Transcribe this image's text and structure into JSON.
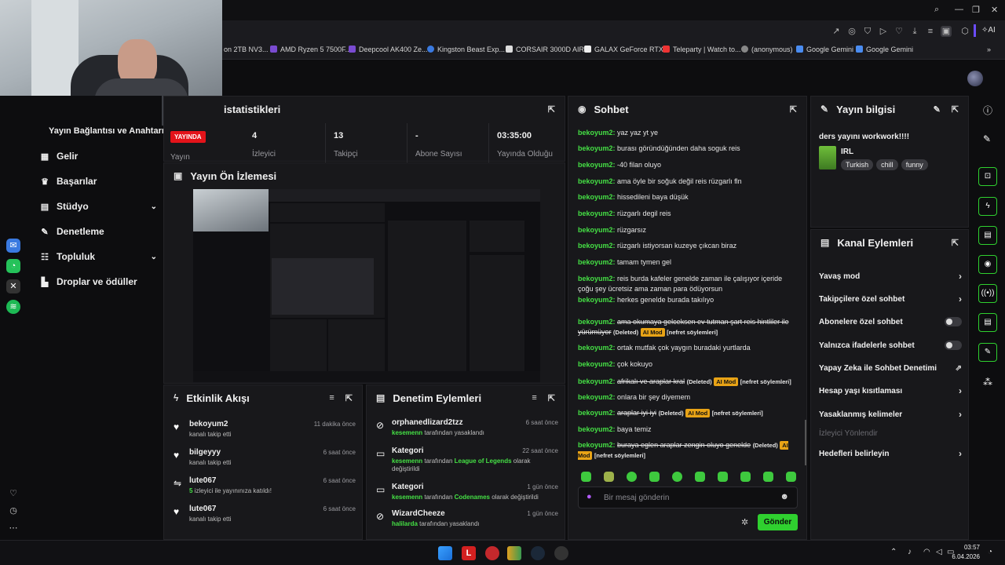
{
  "browser": {
    "bookmarks": [
      "on 2TB NV3...",
      "AMD Ryzen 5 7500F...",
      "Deepcool AK400 Ze...",
      "Kingston Beast Exp...",
      "CORSAIR 3000D AIR...",
      "GALAX GeForce RTX...",
      "Teleparty | Watch to...",
      "(anonymous)",
      "Google Gemini",
      "Google Gemini"
    ],
    "ai_label": "AI"
  },
  "sidebar": {
    "section_title": "Yayın Bağlantısı ve Anahtarı",
    "items": [
      {
        "label": "Gelir",
        "icon": "dollar-icon"
      },
      {
        "label": "Başarılar",
        "icon": "trophy-icon"
      },
      {
        "label": "Stüdyo",
        "icon": "studio-icon",
        "expandable": true
      },
      {
        "label": "Denetleme",
        "icon": "wrench-icon"
      },
      {
        "label": "Topluluk",
        "icon": "community-icon",
        "expandable": true
      },
      {
        "label": "Droplar ve ödüller",
        "icon": "drops-icon"
      }
    ]
  },
  "stats": {
    "title": "istatistikleri",
    "live_badge": "YAYINDA",
    "live_label": "Yayın",
    "items": [
      {
        "value": "4",
        "label": "İzleyici"
      },
      {
        "value": "13",
        "label": "Takipçi"
      },
      {
        "value": "-",
        "label": "Abone Sayısı"
      },
      {
        "value": "03:35:00",
        "label": "Yayında Olduğu"
      }
    ]
  },
  "preview": {
    "title": "Yayın Ön İzlemesi"
  },
  "activity": {
    "title": "Etkinlik Akışı",
    "items": [
      {
        "name": "bekoyum2",
        "sub": "kanalı takip etti",
        "time": "11 dakika önce",
        "icon": "heart-icon"
      },
      {
        "name": "bilgeyyy",
        "sub": "kanalı takip etti",
        "time": "6 saat önce",
        "icon": "heart-icon"
      },
      {
        "name": "lute067",
        "count": "5",
        "sub": " izleyici ile yayınınıza katıldı!",
        "time": "6 saat önce",
        "icon": "raid-icon"
      },
      {
        "name": "lute067",
        "sub": "kanalı takip etti",
        "time": "6 saat önce",
        "icon": "heart-icon"
      }
    ]
  },
  "modactions": {
    "title": "Denetim Eylemleri",
    "items": [
      {
        "name": "orphanedlizard2tzz",
        "actor": "kesemenn",
        "text": " tarafından yasaklandı",
        "time": "6 saat önce",
        "icon": "ban-icon"
      },
      {
        "name": "Kategori",
        "actor": "kesemenn",
        "text": " tarafından ",
        "target": "League of Legends",
        "text2": " olarak değiştirildi",
        "time": "22 saat önce",
        "icon": "category-icon"
      },
      {
        "name": "Kategori",
        "actor": "kesemenn",
        "text": " tarafından ",
        "target": "Codenames",
        "text2": " olarak değiştirildi",
        "time": "1 gün önce",
        "icon": "category-icon"
      },
      {
        "name": "WizardCheeze",
        "actor": "halilarda",
        "text": " tarafından yasaklandı",
        "time": "1 gün önce",
        "icon": "ban-icon"
      }
    ]
  },
  "chat": {
    "title": "Sohbet",
    "user": "bekoyum2:",
    "messages": [
      {
        "text": "yaz yaz yt ye"
      },
      {
        "text": "burası göründüğünden daha soguk reis"
      },
      {
        "text": "-40 filan oluyo"
      },
      {
        "text": "ama öyle bir soğuk değil reis rüzgarlı fln"
      },
      {
        "text": "hissedileni baya düşük"
      },
      {
        "text": "rüzgarlı degil reis"
      },
      {
        "text": "rüzgarsız"
      },
      {
        "text": "rüzgarlı istiyorsan kuzeye çıkcan biraz"
      },
      {
        "text": "tamam tymen gel"
      },
      {
        "text": "reis burda kafeler genelde zaman ile çalışıyor içeride çoğu şey ücretsiz ama zaman para ödüyorsun"
      },
      {
        "text": "herkes genelde burada takılıyo"
      },
      {
        "text": "ama okumaya gelceksen ev tutman şart reis hintliler ile yürümüyor",
        "deleted": true
      },
      {
        "text": "ortak mutfak çok yaygın buradaki yurtlarda"
      },
      {
        "text": "çok kokuyo"
      },
      {
        "text": "afrikalı ve araplar kral",
        "deleted": true
      },
      {
        "text": "onlara bir şey diyemem"
      },
      {
        "text": "araplar iyi iyi",
        "deleted": true
      },
      {
        "text": "baya temiz"
      },
      {
        "text": "buraya eglen araplar zengin oluyo genelde",
        "deleted": true
      }
    ],
    "deleted_label": "(Deleted)",
    "ai_mod": "AI Mod",
    "reason": "[nefret söylemleri]",
    "input_placeholder": "Bir mesaj gönderin",
    "send_label": "Gönder"
  },
  "streaminfo": {
    "title": "Yayın bilgisi",
    "stream_title": "ders yayını workwork!!!!",
    "category": "IRL",
    "tags": [
      "Turkish",
      "chill",
      "funny"
    ]
  },
  "channel_actions": {
    "title": "Kanal Eylemleri",
    "items": [
      {
        "label": "Yavaş mod",
        "control": "chevron"
      },
      {
        "label": "Takipçilere özel sohbet",
        "control": "chevron"
      },
      {
        "label": "Abonelere özel sohbet",
        "control": "toggle"
      },
      {
        "label": "Yalnızca ifadelerle sohbet",
        "control": "toggle"
      },
      {
        "label": "Yapay Zeka ile Sohbet Denetimi",
        "control": "external"
      },
      {
        "label": "Hesap yaşı kısıtlaması",
        "control": "chevron"
      },
      {
        "label": "Yasaklanmış kelimeler",
        "control": "chevron"
      },
      {
        "label": "İzleyici Yönlendir",
        "control": "none",
        "disabled": true
      },
      {
        "label": "Hedefleri belirleyin",
        "control": "chevron"
      }
    ]
  },
  "taskbar": {
    "time": "03:57",
    "date": "6.04.2026"
  },
  "colors": {
    "accent": "#2fd02f",
    "username": "#45e045",
    "live": "#e3131a",
    "aimod": "#e8a316"
  }
}
